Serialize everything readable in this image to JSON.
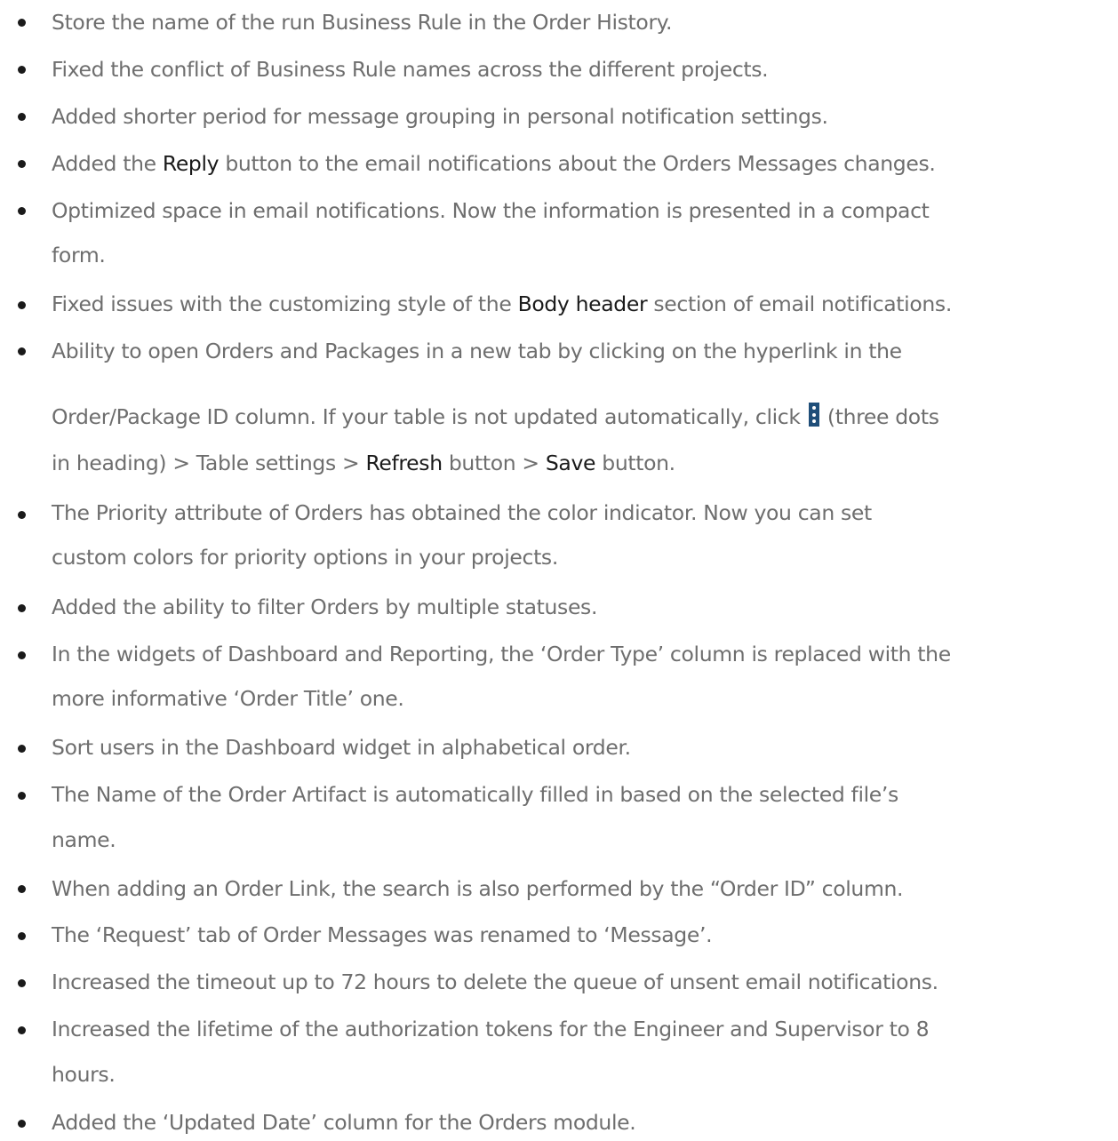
{
  "items": [
    {
      "line1": "Store the name of the run Business Rule in the Order History."
    },
    {
      "line1": "Fixed the conflict of Business Rule names across the different projects."
    },
    {
      "line1": "Added shorter period for message grouping in personal notification settings."
    },
    {
      "pre": "Added the ",
      "bold": "Reply",
      "post": " button to the email notifications about the Orders Messages changes."
    },
    {
      "line1": "Optimized space in email notifications. Now the information is presented in a compact",
      "line2": "form."
    },
    {
      "pre": "Fixed issues with the customizing style of the ",
      "bold": "Body header",
      "post": " section of email notifications."
    },
    {
      "line1": "Ability to open Orders and Packages in a new tab by clicking on the hyperlink in the",
      "line2_pre": "Order/Package ID column. If your table is not updated automatically, click ",
      "line2_post": " (three dots",
      "line3_a": "in heading) > Table settings > ",
      "line3_b": "Refresh",
      "line3_c": " button > ",
      "line3_d": "Save",
      "line3_e": " button.",
      "icon": "three-dots-vertical-icon"
    },
    {
      "line1": "The Priority attribute of Orders has obtained the color indicator. Now you can set",
      "line2": "custom colors for priority options in your projects."
    },
    {
      "line1": "Added the ability to filter Orders by multiple statuses."
    },
    {
      "line1": "In the widgets of Dashboard and Reporting, the ‘Order Type’ column is replaced with the",
      "line2": "more informative ‘Order Title’ one."
    },
    {
      "line1": "Sort users in the Dashboard widget in alphabetical order."
    },
    {
      "line1": "The Name of the Order Artifact is automatically filled in based on the selected file’s",
      "line2": "name."
    },
    {
      "line1": "When adding an Order Link, the search is also performed by the “Order ID” column."
    },
    {
      "line1": "The ‘Request’ tab of Order Messages was renamed to ‘Message’."
    },
    {
      "line1": "Increased the timeout up to 72 hours to delete the queue of unsent email notifications."
    },
    {
      "line1": "Increased the lifetime of the authorization tokens for the Engineer and Supervisor to 8",
      "line2": "hours."
    },
    {
      "line1": "Added the ‘Updated Date’ column for the Orders module."
    }
  ]
}
